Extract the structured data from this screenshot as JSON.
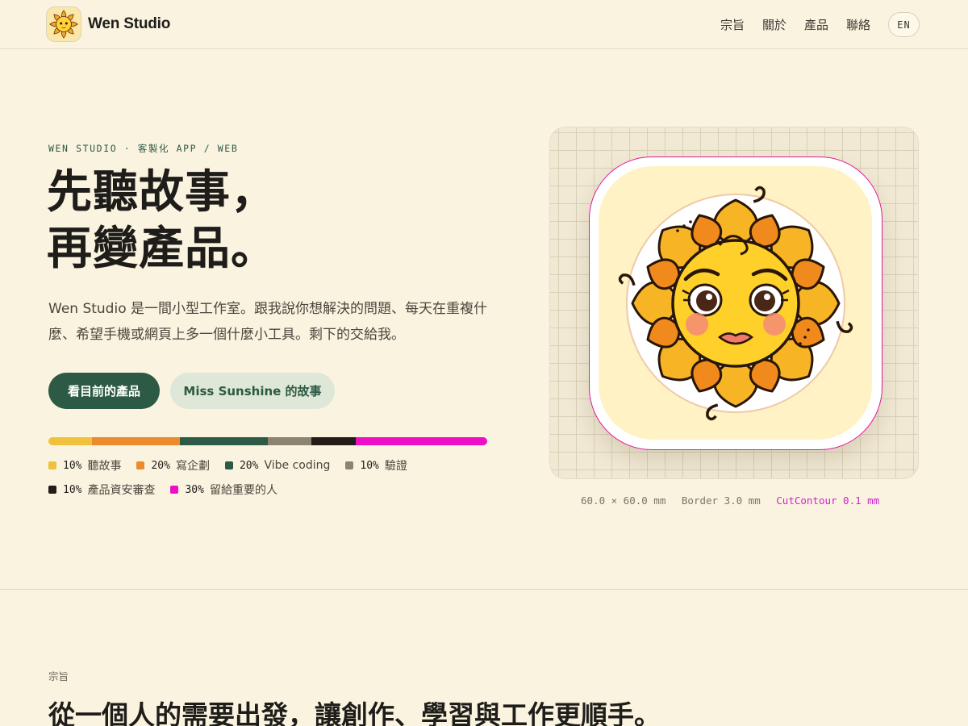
{
  "header": {
    "brand_name": "Wen Studio",
    "nav": [
      "宗旨",
      "關於",
      "產品",
      "聯絡"
    ],
    "lang_label": "EN"
  },
  "hero": {
    "eyebrow": "WEN STUDIO · 客製化 APP / WEB",
    "headline_line1": "先聽故事，",
    "headline_line2": "再變產品。",
    "intro": "Wen Studio 是一間小型工作室。跟我說你想解決的問題、每天在重複什麼、希望手機或網頁上多一個什麼小工具。剩下的交給我。",
    "primary_button": "看目前的產品",
    "secondary_button": "Miss Sunshine 的故事"
  },
  "breakdown": [
    {
      "pct_label": "10%",
      "value": 10,
      "label": "聽故事",
      "color": "#f0c23b"
    },
    {
      "pct_label": "20%",
      "value": 20,
      "label": "寫企劃",
      "color": "#ec8a2e"
    },
    {
      "pct_label": "20%",
      "value": 20,
      "label": "Vibe coding",
      "color": "#2d5a45"
    },
    {
      "pct_label": "10%",
      "value": 10,
      "label": "驗證",
      "color": "#8c8471"
    },
    {
      "pct_label": "10%",
      "value": 10,
      "label": "產品資安審查",
      "color": "#231c17"
    },
    {
      "pct_label": "30%",
      "value": 30,
      "label": "留給重要的人",
      "color": "#ee0ec6"
    }
  ],
  "artwork": {
    "specs": [
      "60.0 × 60.0 mm",
      "Border 3.0 mm",
      "CutContour 0.1 mm"
    ]
  },
  "section2": {
    "eyebrow": "宗旨",
    "title": "從一個人的需要出發，讓創作、學習與工作更順手。"
  }
}
